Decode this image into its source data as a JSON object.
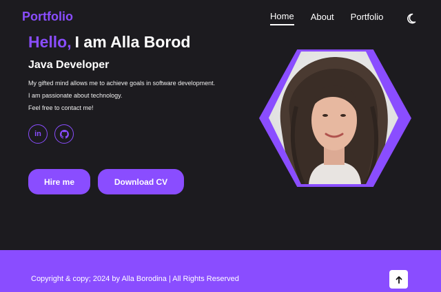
{
  "header": {
    "logo": "Portfolio",
    "nav": [
      "Home",
      "About",
      "Portfolio"
    ],
    "theme_icon": "moon-icon"
  },
  "hero": {
    "hello": "Hello,",
    "title_rest": "I am Alla Borod",
    "subtitle": "Java Developer",
    "bio": [
      "My gifted mind allows me to achieve goals in software development.",
      "I am passionate about technology.",
      "Feel free to contact me!"
    ],
    "socials": [
      {
        "icon": "linkedin-icon",
        "glyph": "in"
      },
      {
        "icon": "github-icon",
        "glyph": ""
      }
    ],
    "buttons": {
      "hire": "Hire me",
      "cv": "Download CV"
    }
  },
  "footer": {
    "copyright": "Copyright & copy; 2024 by Alla Borodina | All Rights Reserved",
    "scroll_icon": "arrow-up-icon"
  },
  "colors": {
    "accent": "#8a4dff",
    "background": "#1c1b1f",
    "text": "#ffffff"
  }
}
